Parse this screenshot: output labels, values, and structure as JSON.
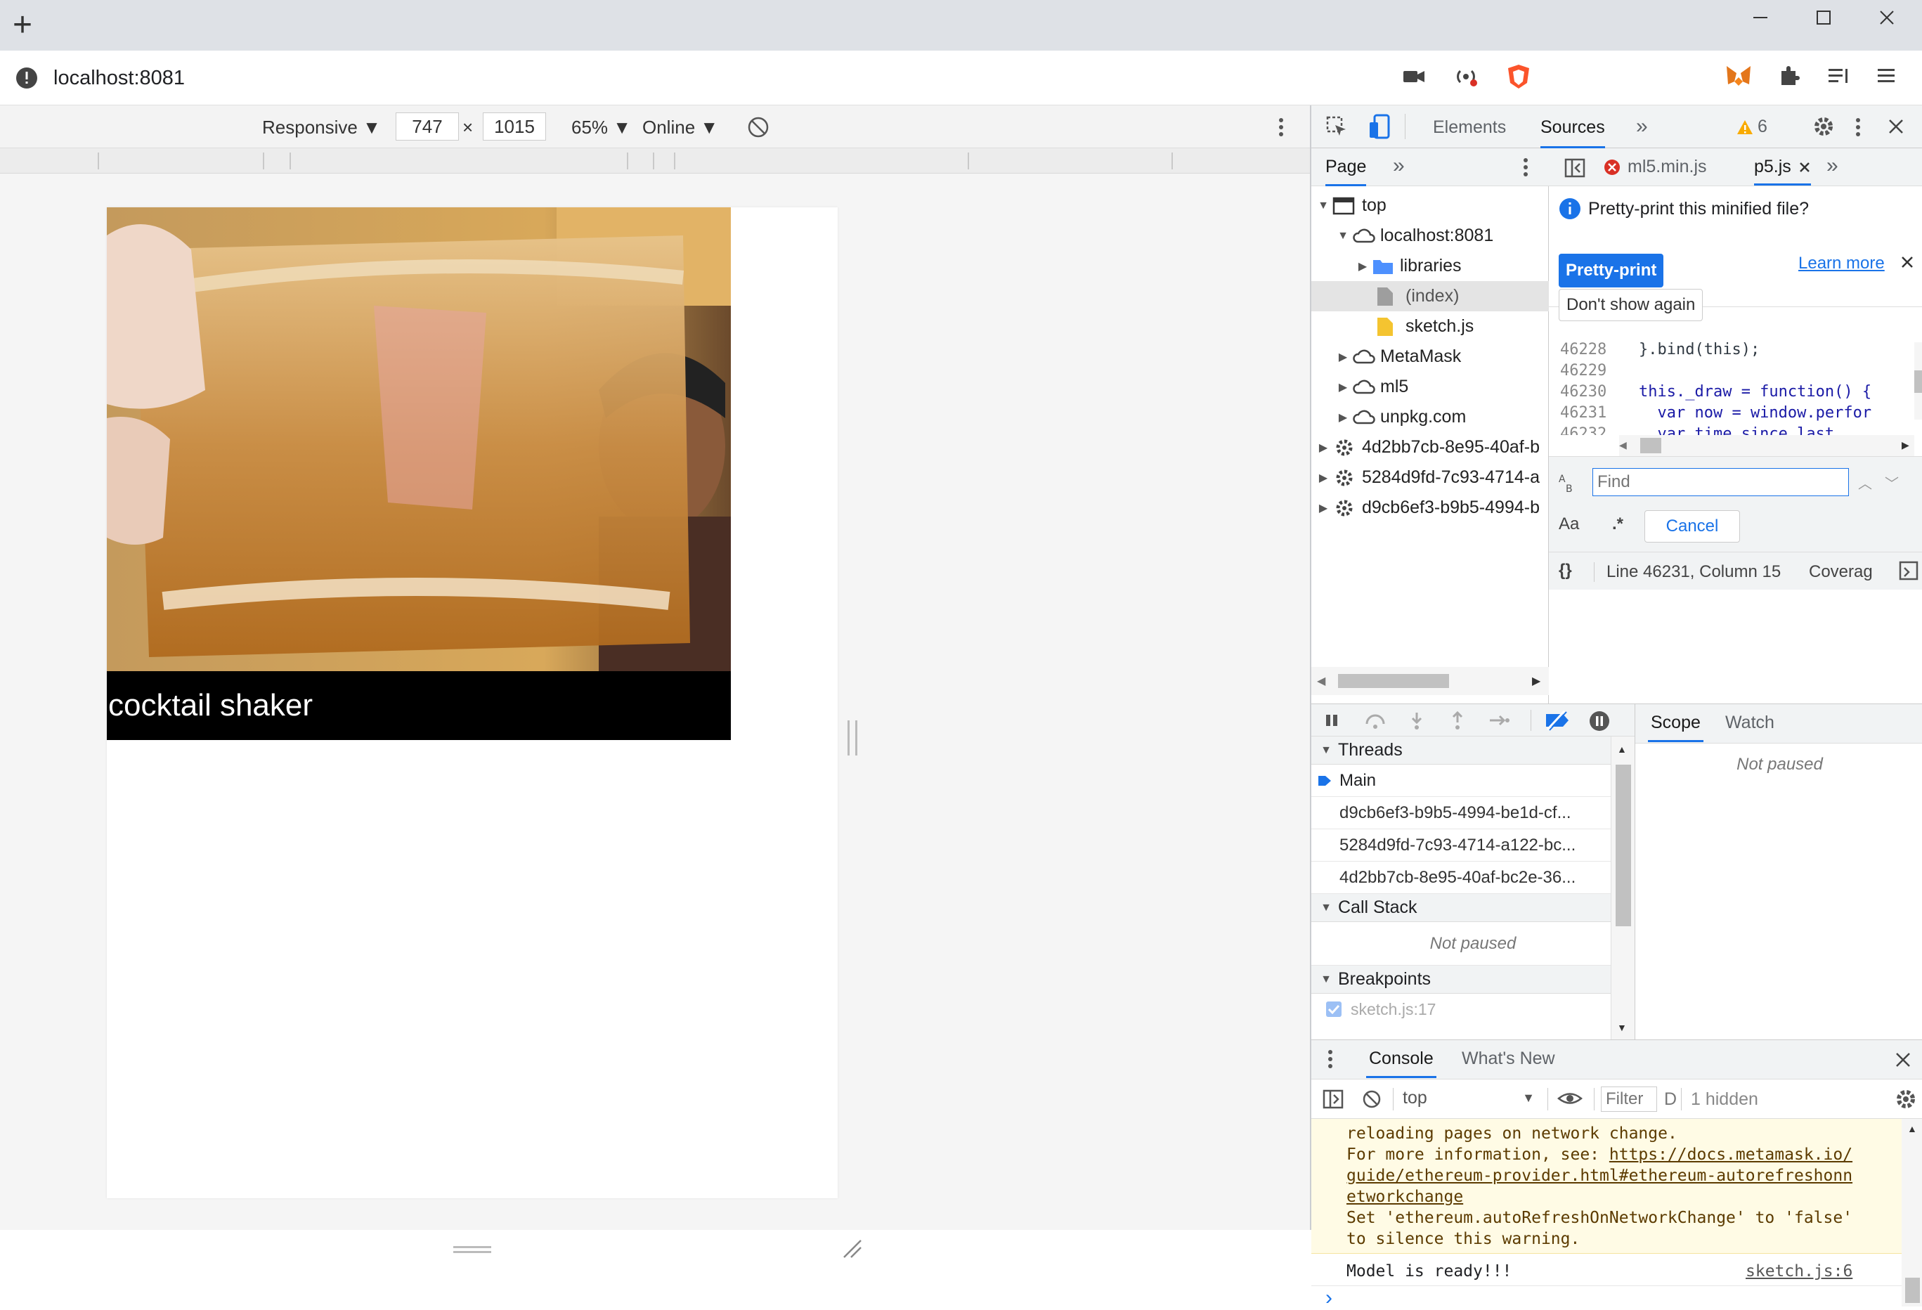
{
  "browser": {
    "new_tab_glyph": "+",
    "address": "localhost:8081",
    "window_controls": [
      "minimize-icon",
      "maximize-icon",
      "close-icon"
    ]
  },
  "device_toolbar": {
    "mode": "Responsive ▼",
    "width": "747",
    "times": "×",
    "height": "1015",
    "zoom": "65% ▼",
    "network": "Online ▼"
  },
  "page": {
    "prediction_label": "cocktail shaker"
  },
  "devtools": {
    "tabs": [
      "Elements",
      "Sources"
    ],
    "active_tab": "Sources",
    "more_tabs": "»",
    "warnings_count": "6",
    "navigator": {
      "tab": "Page",
      "more": "»",
      "tree": [
        {
          "label": "top",
          "icon": "frame-icon"
        },
        {
          "label": "localhost:8081",
          "icon": "cloud-icon"
        },
        {
          "label": "libraries",
          "icon": "folder-icon"
        },
        {
          "label": "(index)",
          "icon": "file-icon"
        },
        {
          "label": "sketch.js",
          "icon": "file-icon"
        },
        {
          "label": "MetaMask",
          "icon": "cloud-icon"
        },
        {
          "label": "ml5",
          "icon": "cloud-icon"
        },
        {
          "label": "unpkg.com",
          "icon": "cloud-icon"
        },
        {
          "label": "4d2bb7cb-8e95-40af-b",
          "icon": "gear-icon"
        },
        {
          "label": "5284d9fd-7c93-4714-a",
          "icon": "gear-icon"
        },
        {
          "label": "d9cb6ef3-b9b5-4994-b",
          "icon": "gear-icon"
        }
      ]
    },
    "editor": {
      "file_tabs": [
        "ml5.min.js",
        "p5.js"
      ],
      "active_file": "p5.js",
      "more": "»",
      "infobar_text": "Pretty-print this minified file?",
      "pretty_print": "Pretty-print",
      "learn_more": "Learn more",
      "dont_show": "Don't show again",
      "lines": [
        {
          "num": "46228",
          "code": "}.bind(this);"
        },
        {
          "num": "46229",
          "code": ""
        },
        {
          "num": "46230",
          "code": "this._draw = function() {"
        },
        {
          "num": "46231",
          "code": "  var now = window.perfor"
        },
        {
          "num": "46232",
          "code": "  var time_since_last"
        }
      ],
      "find_placeholder": "Find",
      "match_case": "Aa",
      "regex": ".*",
      "cancel": "Cancel",
      "braces": "{}",
      "status": "Line 46231, Column 15",
      "coverage": "Coverag"
    },
    "debugger": {
      "threads_title": "Threads",
      "threads": [
        "Main",
        "d9cb6ef3-b9b5-4994-be1d-cf...",
        "5284d9fd-7c93-4714-a122-bc...",
        "4d2bb7cb-8e95-40af-bc2e-36..."
      ],
      "call_stack_title": "Call Stack",
      "call_stack_status": "Not paused",
      "breakpoints_title": "Breakpoints",
      "breakpoint": "sketch.js:17",
      "scope_tab": "Scope",
      "watch_tab": "Watch",
      "scope_status": "Not paused"
    },
    "drawer": {
      "tabs": [
        "Console",
        "What's New"
      ],
      "context": "top",
      "filter_placeholder": "Filter",
      "levels": "D",
      "hidden": "1 hidden",
      "warning_lines": [
        "reloading pages on network change.",
        "For more information, see: ",
        "Set 'ethereum.autoRefreshOnNetworkChange' to 'false'",
        "to silence this warning."
      ],
      "warning_link_lines": [
        "https://docs.metamask.io/",
        "guide/ethereum-provider.html#ethereum-autorefreshonn",
        "etworkchange"
      ],
      "log": "Model is ready!!!",
      "log_source": "sketch.js:6",
      "prompt": "›"
    }
  },
  "colors": {
    "accent": "#1a73e8",
    "brave": "#fb542b",
    "metamask": "#f6851b",
    "warning_bg": "#fffbe5"
  }
}
